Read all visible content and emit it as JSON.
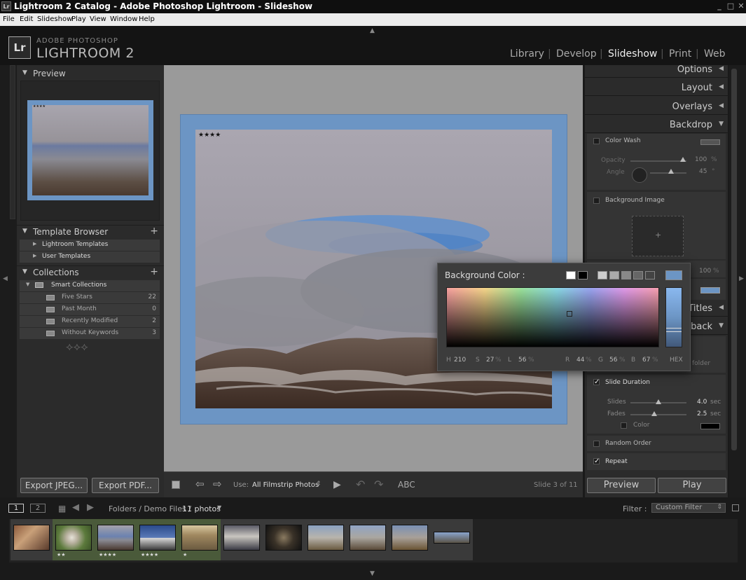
{
  "window": {
    "title": "Lightroom 2 Catalog - Adobe Photoshop Lightroom - Slideshow",
    "app_icon": "Lr"
  },
  "menu": [
    "File",
    "Edit",
    "Slideshow",
    "Play",
    "View",
    "Window",
    "Help"
  ],
  "brand": {
    "line1": "ADOBE PHOTOSHOP",
    "line2": "LIGHTROOM 2",
    "logo": "Lr"
  },
  "modules": [
    "Library",
    "Develop",
    "Slideshow",
    "Print",
    "Web"
  ],
  "active_module": "Slideshow",
  "left_panel": {
    "preview_title": "Preview",
    "preview_stars": "★★★★",
    "template_browser": {
      "title": "Template Browser",
      "items": [
        "Lightroom Templates",
        "User Templates"
      ]
    },
    "collections": {
      "title": "Collections",
      "group": "Smart Collections",
      "items": [
        {
          "name": "Five Stars",
          "count": "22"
        },
        {
          "name": "Past Month",
          "count": "0"
        },
        {
          "name": "Recently Modified",
          "count": "2"
        },
        {
          "name": "Without Keywords",
          "count": "3"
        }
      ]
    },
    "export_jpeg": "Export JPEG...",
    "export_pdf": "Export PDF..."
  },
  "slide": {
    "stars": "★★★★"
  },
  "toolbar": {
    "use_label": "Use:",
    "use_value": "All Filmstrip Photos",
    "abc": "ABC",
    "slide_info": "Slide 3 of 11"
  },
  "right_panel": {
    "sections": [
      "Options",
      "Layout",
      "Overlays",
      "Backdrop",
      "Titles",
      "Playback"
    ],
    "backdrop": {
      "color_wash": "Color Wash",
      "opacity_label": "Opacity",
      "opacity_value": "100",
      "opacity_unit": "%",
      "angle_label": "Angle",
      "angle_value": "45",
      "angle_unit": "°",
      "background_image": "Background Image",
      "bg_opacity_value": "100",
      "bg_opacity_unit": "%",
      "plus": "+"
    },
    "playback": {
      "folder_text": "folder",
      "slide_duration": "Slide Duration",
      "slides_label": "Slides",
      "slides_value": "4.0",
      "slides_unit": "sec",
      "fades_label": "Fades",
      "fades_value": "2.5",
      "fades_unit": "sec",
      "color_label": "Color",
      "random_order": "Random Order",
      "repeat": "Repeat"
    },
    "preview_btn": "Preview",
    "play_btn": "Play"
  },
  "color_picker": {
    "title": "Background Color :",
    "h_label": "H",
    "h_value": "210",
    "s_label": "S",
    "s_value": "27",
    "s_unit": "%",
    "l_label": "L",
    "l_value": "56",
    "l_unit": "%",
    "r_label": "R",
    "r_value": "44",
    "r_unit": "%",
    "g_label": "G",
    "g_value": "56",
    "g_unit": "%",
    "b_label": "B",
    "b_value": "67",
    "b_unit": "%",
    "hex_label": "HEX",
    "selected_color": "#6c95c4"
  },
  "filmstrip": {
    "page1": "1",
    "page2": "2",
    "source_prefix": "Folders / Demo Files /",
    "source_count": "11 photos",
    "filter_label": "Filter :",
    "filter_value": "Custom Filter",
    "thumbs": [
      {
        "stars": ""
      },
      {
        "stars": "★★"
      },
      {
        "stars": "★★★★"
      },
      {
        "stars": "★★★★"
      },
      {
        "stars": "★"
      },
      {
        "stars": ""
      },
      {
        "stars": ""
      },
      {
        "stars": ""
      },
      {
        "stars": ""
      },
      {
        "stars": ""
      },
      {
        "stars": ""
      }
    ]
  },
  "colors": {
    "accent": "#6c95c4",
    "panel": "#2b2b2b",
    "workspace": "#9a9a9a"
  }
}
